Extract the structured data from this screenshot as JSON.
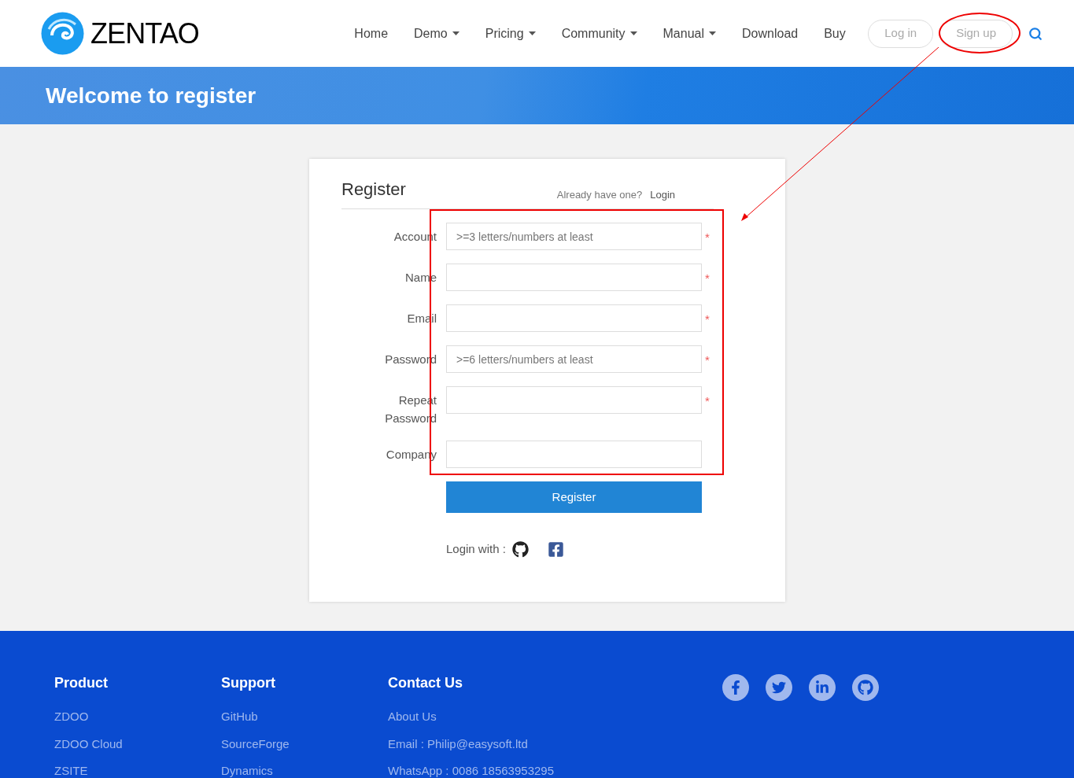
{
  "header": {
    "logo_text": "ZENTAO",
    "nav": [
      {
        "label": "Home",
        "dropdown": false
      },
      {
        "label": "Demo",
        "dropdown": true
      },
      {
        "label": "Pricing",
        "dropdown": true
      },
      {
        "label": "Community",
        "dropdown": true
      },
      {
        "label": "Manual",
        "dropdown": true
      },
      {
        "label": "Download",
        "dropdown": false
      },
      {
        "label": "Buy",
        "dropdown": false
      }
    ],
    "login_button": "Log in",
    "signup_button": "Sign up"
  },
  "banner": {
    "title": "Welcome to register"
  },
  "form": {
    "title": "Register",
    "already": "Already have one?",
    "login_link": "Login",
    "fields": [
      {
        "label": "Account",
        "placeholder": ">=3 letters/numbers at least",
        "required_mark": "*"
      },
      {
        "label": "Name",
        "required_mark": "*"
      },
      {
        "label": "Email",
        "required_mark": "*"
      },
      {
        "label": "Password",
        "placeholder": ">=6 letters/numbers at least",
        "required_mark": "*"
      },
      {
        "label": "Repeat Password",
        "required_mark": "*"
      },
      {
        "label": "Company"
      }
    ],
    "submit": "Register",
    "login_with": "Login with :"
  },
  "footer": {
    "columns": [
      {
        "title": "Product",
        "links": [
          "ZDOO",
          "ZDOO Cloud",
          "ZSITE"
        ]
      },
      {
        "title": "Support",
        "links": [
          "GitHub",
          "SourceForge",
          "Dynamics"
        ]
      },
      {
        "title": "Contact Us",
        "links": [
          "About Us",
          "Email : Philip@easysoft.ltd",
          "WhatsApp : 0086 18563953295"
        ]
      }
    ]
  }
}
